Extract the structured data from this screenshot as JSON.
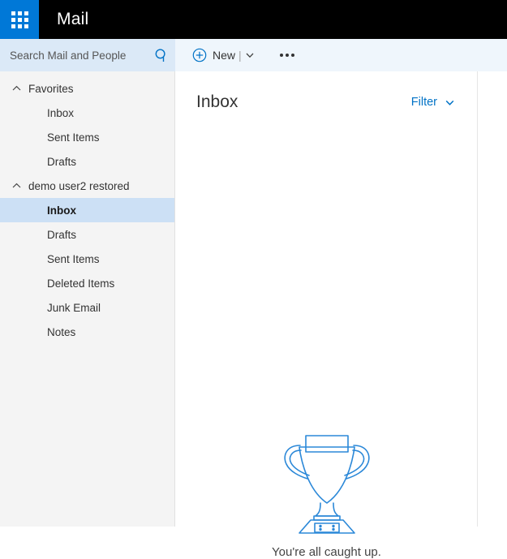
{
  "titlebar": {
    "waffle_icon": "app-launcher-waffle-icon",
    "app_title": "Mail"
  },
  "search": {
    "placeholder": "Search Mail and People",
    "value": "",
    "icon": "search-icon"
  },
  "commandbar": {
    "new_icon": "plus-circle-icon",
    "new_label": "New",
    "new_separator": "|",
    "new_chevron_icon": "chevron-down-icon",
    "more_label": "•••",
    "more_icon": "ellipsis-icon"
  },
  "sidebar": {
    "groups": [
      {
        "label": "Favorites",
        "chevron_icon": "chevron-up-icon",
        "expanded": true,
        "items": [
          {
            "label": "Inbox",
            "selected": false
          },
          {
            "label": "Sent Items",
            "selected": false
          },
          {
            "label": "Drafts",
            "selected": false
          }
        ]
      },
      {
        "label": "demo user2 restored",
        "chevron_icon": "chevron-up-icon",
        "expanded": true,
        "items": [
          {
            "label": "Inbox",
            "selected": true
          },
          {
            "label": "Drafts",
            "selected": false
          },
          {
            "label": "Sent Items",
            "selected": false
          },
          {
            "label": "Deleted Items",
            "selected": false
          },
          {
            "label": "Junk Email",
            "selected": false
          },
          {
            "label": "Notes",
            "selected": false
          }
        ]
      }
    ]
  },
  "list": {
    "title": "Inbox",
    "filter_label": "Filter",
    "filter_chevron_icon": "chevron-down-icon"
  },
  "empty_state": {
    "illustration": "trophy-icon",
    "message": "You're all caught up."
  },
  "colors": {
    "accent_blue": "#0078d7",
    "link_blue": "#0072c6",
    "illustration_blue": "#2b88d8",
    "titlebar_black": "#000000",
    "search_bg": "#dbe9f7",
    "commandbar_bg": "#eff6fc",
    "sidebar_bg": "#f4f4f4",
    "selected_row_bg": "#cce0f5"
  }
}
